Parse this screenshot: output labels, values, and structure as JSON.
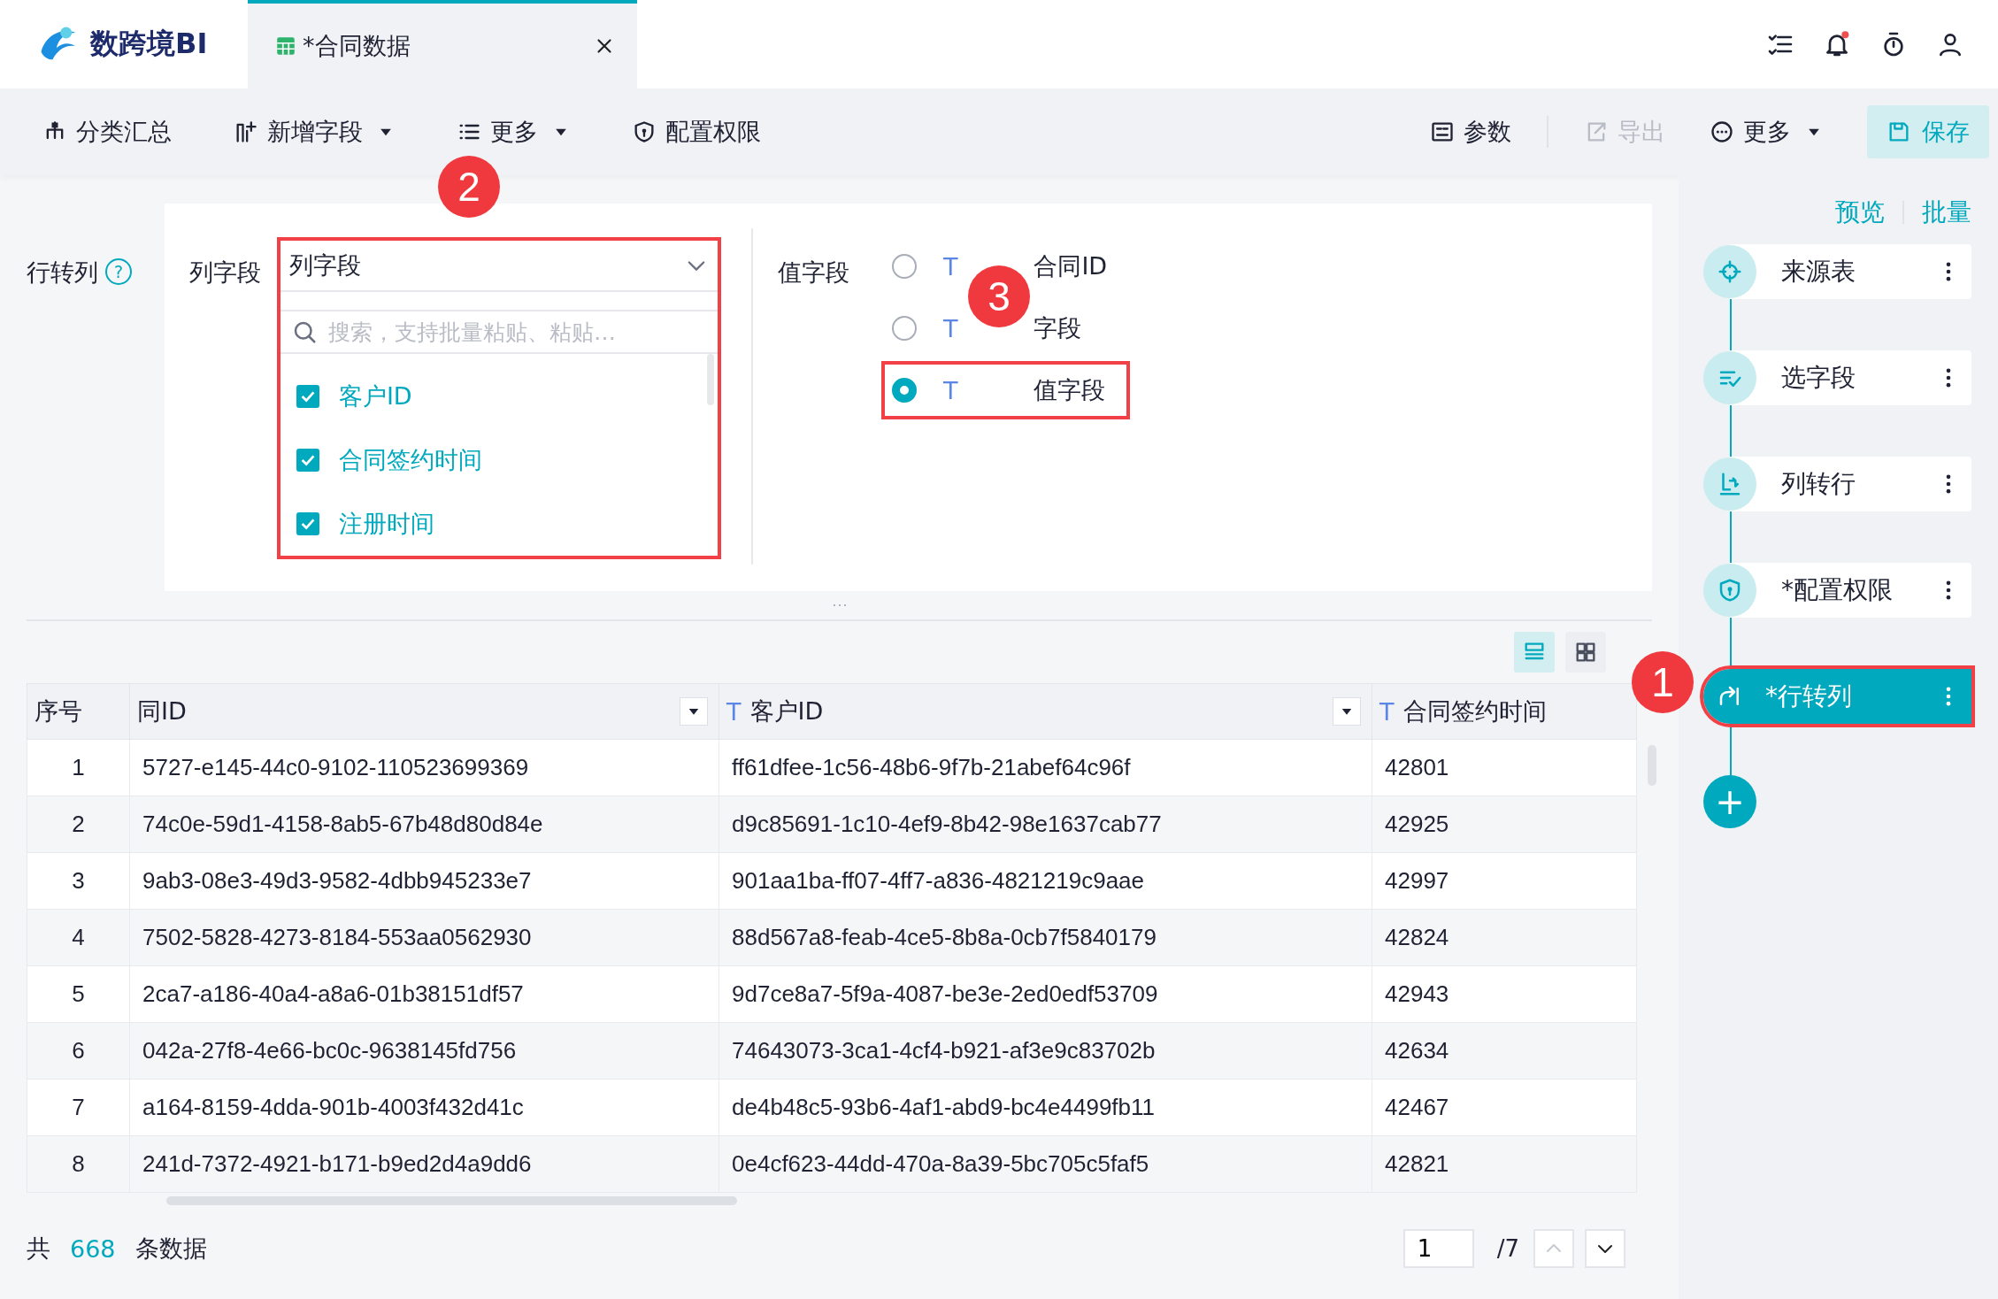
{
  "app": {
    "logo_text": "数跨境BI"
  },
  "tabs": [
    {
      "label": "*合同数据",
      "selected": true
    }
  ],
  "toolbar": {
    "left": [
      {
        "label": "分类汇总",
        "dropdown": false
      },
      {
        "label": "新增字段",
        "dropdown": true
      },
      {
        "label": "更多",
        "dropdown": true
      },
      {
        "label": "配置权限",
        "dropdown": false
      }
    ],
    "right": [
      {
        "label": "参数",
        "dropdown": false,
        "disabled": false
      },
      {
        "label": "导出",
        "dropdown": false,
        "disabled": true
      },
      {
        "label": "更多",
        "dropdown": true,
        "disabled": false
      }
    ],
    "save": {
      "label": "保存"
    }
  },
  "config": {
    "title": "行转列",
    "help": "?",
    "column_field": {
      "label": "列字段",
      "value": "列字段",
      "highlighted": true,
      "search_placeholder": "搜索，支持批量粘贴、粘贴…",
      "options": [
        {
          "label": "客户ID",
          "checked": true
        },
        {
          "label": "合同签约时间",
          "checked": true
        },
        {
          "label": "注册时间",
          "checked": true
        }
      ]
    },
    "value_field": {
      "label": "值字段",
      "options": [
        {
          "type": "T",
          "label": "合同ID",
          "selected": false,
          "highlighted": false
        },
        {
          "type": "T",
          "label": "字段",
          "selected": false,
          "highlighted": false
        },
        {
          "type": "T",
          "label": "值字段",
          "selected": true,
          "highlighted": true
        }
      ]
    }
  },
  "annotations": [
    {
      "number": "1"
    },
    {
      "number": "2"
    },
    {
      "number": "3"
    }
  ],
  "pipeline": {
    "links": [
      {
        "label": "预览"
      },
      {
        "label": "批量"
      }
    ],
    "steps": [
      {
        "label": "来源表",
        "selected": false,
        "highlighted": false
      },
      {
        "label": "选字段",
        "selected": false,
        "highlighted": false
      },
      {
        "label": "列转行",
        "selected": false,
        "highlighted": false
      },
      {
        "label": "*配置权限",
        "selected": false,
        "highlighted": false
      },
      {
        "label": "*行转列",
        "selected": true,
        "highlighted": true
      }
    ],
    "add": "+"
  },
  "view_toggle": [
    {
      "selected": true
    },
    {
      "selected": false
    }
  ],
  "table": {
    "columns": [
      {
        "label": "序号",
        "filter": false
      },
      {
        "label": "同ID",
        "filter": true
      },
      {
        "type": "T",
        "label": "客户ID",
        "filter": true
      },
      {
        "type": "T",
        "label": "合同签约时间",
        "filter": false
      }
    ],
    "rows": [
      [
        "1",
        "5727-e145-44c0-9102-110523699369",
        "ff61dfee-1c56-48b6-9f7b-21abef64c96f",
        "42801"
      ],
      [
        "2",
        "74c0e-59d1-4158-8ab5-67b48d80d84e",
        "d9c85691-1c10-4ef9-8b42-98e1637cab77",
        "42925"
      ],
      [
        "3",
        "9ab3-08e3-49d3-9582-4dbb945233e7",
        "901aa1ba-ff07-4ff7-a836-4821219c9aae",
        "42997"
      ],
      [
        "4",
        "7502-5828-4273-8184-553aa0562930",
        "88d567a8-feab-4ce5-8b8a-0cb7f5840179",
        "42824"
      ],
      [
        "5",
        "2ca7-a186-40a4-a8a6-01b38151df57",
        "9d7ce8a7-5f9a-4087-be3e-2ed0edf53709",
        "42943"
      ],
      [
        "6",
        "042a-27f8-4e66-bc0c-9638145fd756",
        "74643073-3ca1-4cf4-b921-af3e9c83702b",
        "42634"
      ],
      [
        "7",
        "a164-8159-4dda-901b-4003f432d41c",
        "de4b48c5-93b6-4af1-abd9-bc4e4499fb11",
        "42467"
      ],
      [
        "8",
        "241d-7372-4921-b171-b9ed2d4a9dd6",
        "0e4cf623-44dd-470a-8a39-5bc705c5faf5",
        "42821"
      ]
    ]
  },
  "footer": {
    "prefix": "共",
    "count": "668",
    "suffix": "条数据",
    "page": "1",
    "pages": "/7"
  }
}
